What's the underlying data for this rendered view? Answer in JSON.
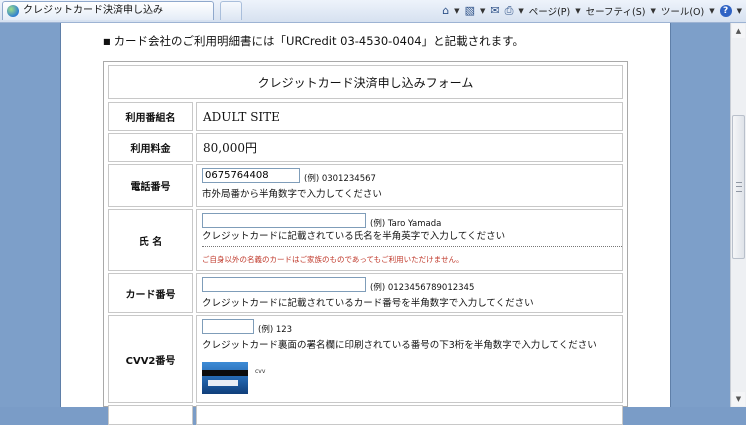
{
  "browser": {
    "tab_title": "クレジットカード決済申し込み",
    "toolbar": {
      "home_icon": "home-icon",
      "page_menu": "ページ(P)",
      "safety_menu": "セーフティ(S)",
      "tools_menu": "ツール(O)"
    }
  },
  "notice": {
    "bullet": "■",
    "text": "カード会社のご利用明細書には「URCredit 03-4530-0404」と記載されます。"
  },
  "form": {
    "title": "クレジットカード決済申し込みフォーム",
    "rows": {
      "site": {
        "label": "利用番組名",
        "value": "ADULT SITE"
      },
      "fee": {
        "label": "利用料金",
        "value": "80,000円"
      },
      "phone": {
        "label": "電話番号",
        "input_value": "0675764408",
        "example": "(例) 0301234567",
        "hint": "市外局番から半角数字で入力してください"
      },
      "name": {
        "label": "氏 名",
        "input_value": "",
        "example": "(例) Taro Yamada",
        "hint": "クレジットカードに記載されている氏名を半角英字で入力してください",
        "warning": "ご自身以外の名義のカードはご家族のものであってもご利用いただけません。"
      },
      "card": {
        "label": "カード番号",
        "input_value": "",
        "example": "(例) 0123456789012345",
        "hint": "クレジットカードに記載されているカード番号を半角数字で入力してください"
      },
      "cvv": {
        "label": "CVV2番号",
        "input_value": "",
        "example": "(例) 123",
        "hint": "クレジットカード裏面の署名欄に印刷されている番号の下3桁を半角数字で入力してください",
        "card_caption": "cvv"
      }
    }
  }
}
